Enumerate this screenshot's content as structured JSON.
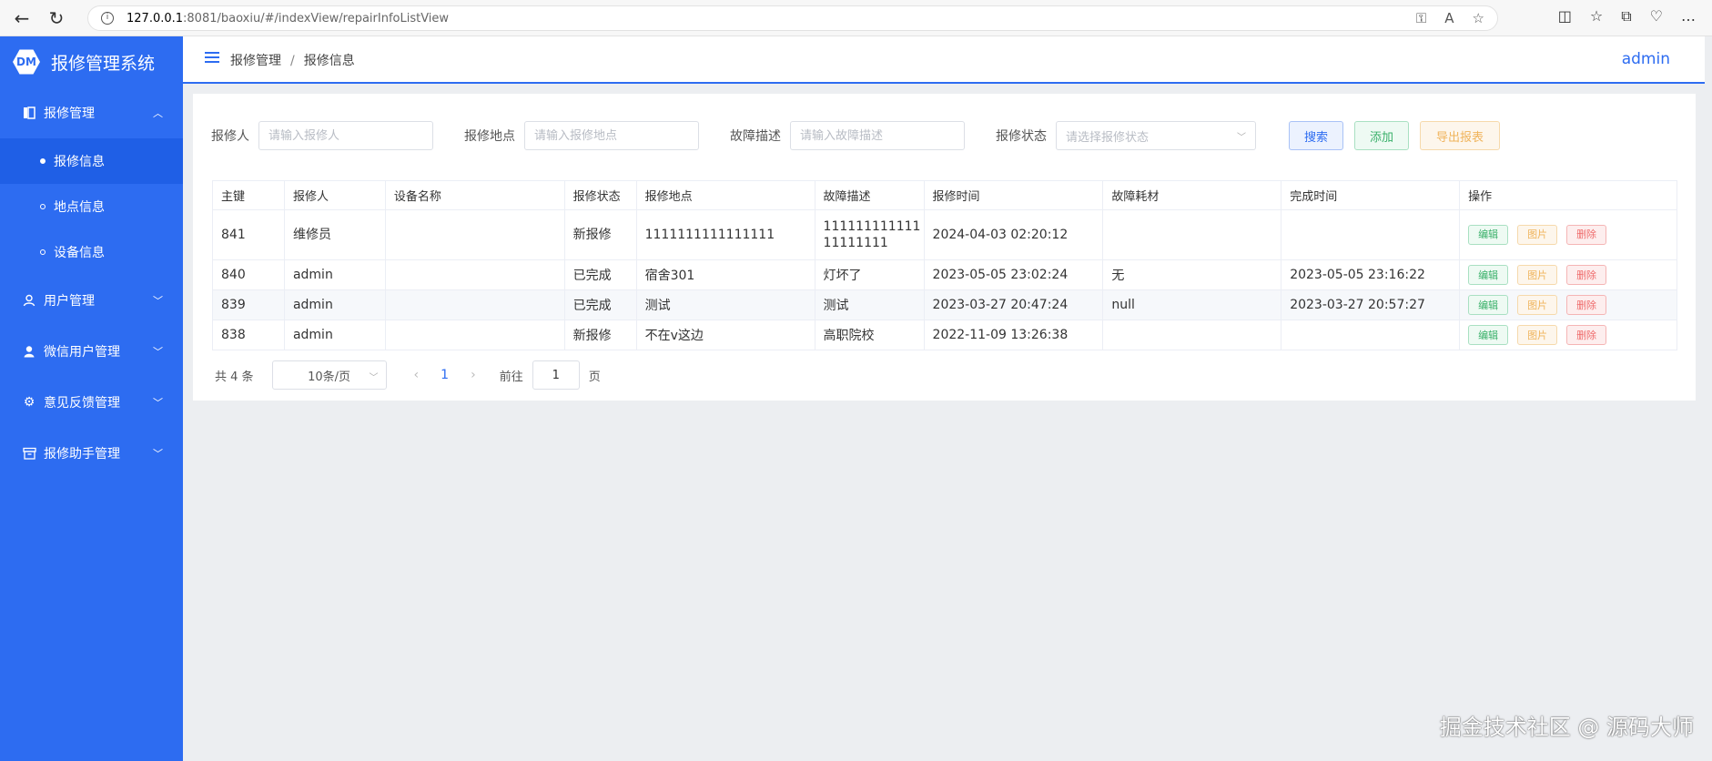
{
  "browser": {
    "url_host": "127.0.0.1",
    "url_rest": ":8081/baoxiu/#/indexView/repairInfoListView"
  },
  "sidebar": {
    "logo_text": "DM",
    "title": "报修管理系统",
    "menu": [
      {
        "label": "报修管理",
        "icon": "book-icon",
        "expanded": true
      },
      {
        "label": "用户管理",
        "icon": "user-outline-icon"
      },
      {
        "label": "微信用户管理",
        "icon": "user-filled-icon"
      },
      {
        "label": "意见反馈管理",
        "icon": "gear-icon"
      },
      {
        "label": "报修助手管理",
        "icon": "box-icon"
      }
    ],
    "submenu": [
      {
        "label": "报修信息",
        "active": true
      },
      {
        "label": "地点信息"
      },
      {
        "label": "设备信息"
      }
    ]
  },
  "header": {
    "breadcrumb": [
      "报修管理",
      "报修信息"
    ],
    "user": "admin"
  },
  "filters": {
    "reporter_label": "报修人",
    "reporter_placeholder": "请输入报修人",
    "location_label": "报修地点",
    "location_placeholder": "请输入报修地点",
    "desc_label": "故障描述",
    "desc_placeholder": "请输入故障描述",
    "status_label": "报修状态",
    "status_placeholder": "请选择报修状态"
  },
  "buttons": {
    "search": "搜索",
    "add": "添加",
    "export": "导出报表"
  },
  "table": {
    "headers": [
      "主键",
      "报修人",
      "设备名称",
      "报修状态",
      "报修地点",
      "故障描述",
      "报修时间",
      "故障耗材",
      "完成时间",
      "操作"
    ],
    "rows": [
      {
        "id": "841",
        "reporter": "维修员",
        "device": "",
        "status": "新报修",
        "location": "1111111111111111",
        "desc_line1": "111111111111",
        "desc_line2": "11111111",
        "time": "2024-04-03 02:20:12",
        "material": "",
        "done": ""
      },
      {
        "id": "840",
        "reporter": "admin",
        "device": "",
        "status": "已完成",
        "location": "宿舍301",
        "desc_line1": "灯坏了",
        "desc_line2": "",
        "time": "2023-05-05 23:02:24",
        "material": "无",
        "done": "2023-05-05 23:16:22"
      },
      {
        "id": "839",
        "reporter": "admin",
        "device": "",
        "status": "已完成",
        "location": "测试",
        "desc_line1": "测试",
        "desc_line2": "",
        "time": "2023-03-27 20:47:24",
        "material": "null",
        "done": "2023-03-27 20:57:27"
      },
      {
        "id": "838",
        "reporter": "admin",
        "device": "",
        "status": "新报修",
        "location": "不在v这边",
        "desc_line1": "高职院校",
        "desc_line2": "",
        "time": "2022-11-09 13:26:38",
        "material": "",
        "done": ""
      }
    ],
    "op_edit": "编辑",
    "op_pic": "图片",
    "op_delete": "删除"
  },
  "pagination": {
    "total": "共 4 条",
    "page_size": "10条/页",
    "current": "1",
    "goto_label": "前往",
    "goto_value": "1",
    "page_unit": "页"
  },
  "watermark": "掘金技术社区 @ 源码大师",
  "colors": {
    "primary": "#2d6cf1",
    "success": "#3ab06a",
    "warning": "#f0b45c",
    "danger": "#ef6b6b"
  }
}
